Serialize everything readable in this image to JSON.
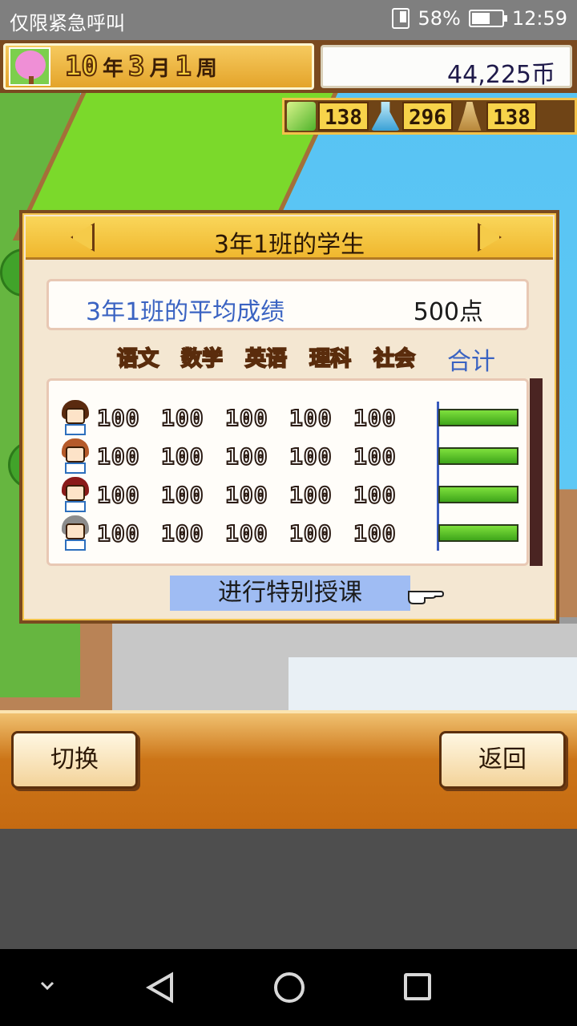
{
  "status_bar": {
    "carrier": "仅限紧急呼叫",
    "battery": "58%",
    "time": "12:59"
  },
  "hud": {
    "year_num": "10",
    "year_unit": "年",
    "month_num": "3",
    "month_unit": "月",
    "week_num": "1",
    "week_unit": "周",
    "money": "44,225币",
    "resources": [
      {
        "icon": "pencil-icon",
        "value": "138"
      },
      {
        "icon": "flask-icon",
        "value": "296"
      },
      {
        "icon": "pawn-icon",
        "value": "138"
      }
    ]
  },
  "dialog": {
    "title": "3年1班的学生",
    "average_label": "3年1班的平均成绩",
    "average_value": "500点",
    "subjects": [
      "语文",
      "数学",
      "英语",
      "理科",
      "社会"
    ],
    "total_label": "合计",
    "students": [
      {
        "hair": "#5a2a0f",
        "scores": [
          "100",
          "100",
          "100",
          "100",
          "100"
        ],
        "total_fraction": 1.0
      },
      {
        "hair": "#b55a2a",
        "scores": [
          "100",
          "100",
          "100",
          "100",
          "100"
        ],
        "total_fraction": 1.0
      },
      {
        "hair": "#8a1a1a",
        "scores": [
          "100",
          "100",
          "100",
          "100",
          "100"
        ],
        "total_fraction": 1.0
      },
      {
        "hair": "#8c8c8c",
        "scores": [
          "100",
          "100",
          "100",
          "100",
          "100"
        ],
        "total_fraction": 1.0
      }
    ],
    "special_button": "进行特别授课"
  },
  "bottom": {
    "switch_label": "切换",
    "back_label": "返回"
  },
  "colors": {
    "accent_blue": "#3a63c2",
    "bar_green": "#3ea51a",
    "panel_gold": "#f0b72e"
  }
}
